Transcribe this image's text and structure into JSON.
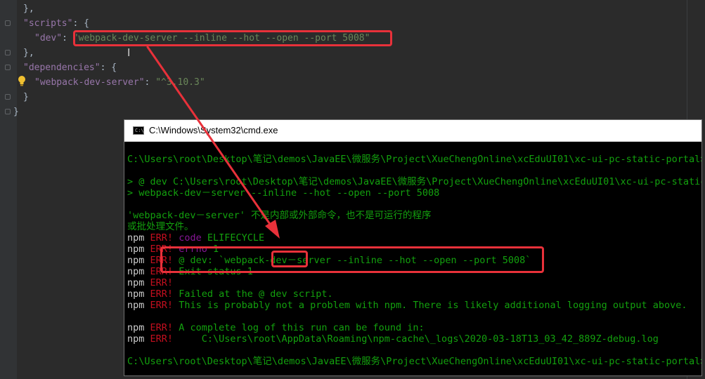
{
  "editor": {
    "lines": [
      {
        "text": "},"
      },
      {
        "key": "\"scripts\"",
        "rest": ": {"
      },
      {
        "key": "\"dev\"",
        "colon": ": ",
        "value": "\"webpack-dev-server --inline --hot --open --port 5008\""
      },
      {
        "text": "},"
      },
      {
        "key": "\"dependencies\"",
        "rest": ": {"
      },
      {
        "key": "\"webpack-dev-server\"",
        "colon": ": ",
        "value": "\"^3.10.3\""
      },
      {
        "text": "}"
      },
      {
        "text": "}"
      }
    ]
  },
  "cmd": {
    "title": "C:\\Windows\\System32\\cmd.exe",
    "lines": [
      {
        "path": "C:\\Users\\root\\Desktop\\笔记\\demos\\JavaEE\\微服务\\Project\\XueChengOnline\\xcEduUI01\\xc-ui-pc-static-portal>"
      },
      {
        "path": "> @ dev C:\\Users\\root\\Desktop\\笔记\\demos\\JavaEE\\微服务\\Project\\XueChengOnline\\xcEduUI01\\xc-ui-pc-static-portal"
      },
      {
        "path": "> webpack-dev－server --inline --hot --open --port 5008"
      },
      {
        "path": "'webpack-dev－server' 不是内部或外部命令，也不是可运行的程序"
      },
      {
        "path": "或批处理文件。"
      },
      {
        "npm": "npm",
        "err": "ERR!",
        "mag": "code",
        "msg": "ELIFECYCLE"
      },
      {
        "npm": "npm",
        "err": "ERR!",
        "mag": "errno",
        "msg": "1"
      },
      {
        "npm": "npm",
        "err": "ERR!",
        "msg": "@ dev: `webpack-dev－server --inline --hot --open --port 5008`"
      },
      {
        "npm": "npm",
        "err": "ERR!",
        "msg": "Exit status 1"
      },
      {
        "npm": "npm",
        "err": "ERR!",
        "msg": ""
      },
      {
        "npm": "npm",
        "err": "ERR!",
        "msg": "Failed at the @ dev script."
      },
      {
        "npm": "npm",
        "err": "ERR!",
        "msg": "This is probably not a problem with npm. There is likely additional logging output above."
      },
      {
        "npm": "npm",
        "err": "ERR!",
        "msg": "A complete log of this run can be found in:"
      },
      {
        "npm": "npm",
        "err": "ERR!",
        "msg": "    C:\\Users\\root\\AppData\\Roaming\\npm-cache\\_logs\\2020-03-18T13_03_42_889Z-debug.log"
      },
      {
        "path": "C:\\Users\\root\\Desktop\\笔记\\demos\\JavaEE\\微服务\\Project\\XueChengOnline\\xcEduUI01\\xc-ui-pc-static-portal>"
      }
    ]
  },
  "colors": {
    "annotation": "#e8313a",
    "console_green": "#13a10e",
    "console_err": "#c50f1f",
    "json_key": "#9876aa",
    "json_string": "#6a8759"
  }
}
